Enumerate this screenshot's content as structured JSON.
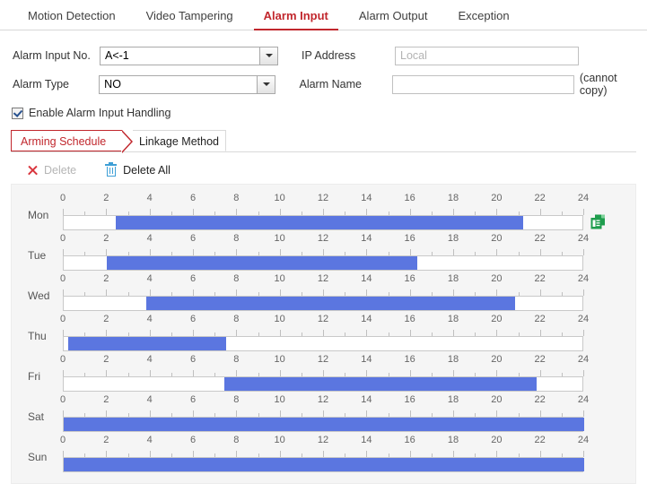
{
  "tabs": [
    {
      "label": "Motion Detection",
      "active": false
    },
    {
      "label": "Video Tampering",
      "active": false
    },
    {
      "label": "Alarm Input",
      "active": true
    },
    {
      "label": "Alarm Output",
      "active": false
    },
    {
      "label": "Exception",
      "active": false
    }
  ],
  "form": {
    "alarm_input_no_label": "Alarm Input No.",
    "alarm_input_no_value": "A<-1",
    "ip_address_label": "IP Address",
    "ip_address_value": "",
    "ip_address_placeholder": "Local",
    "alarm_type_label": "Alarm Type",
    "alarm_type_value": "NO",
    "alarm_name_label": "Alarm Name",
    "alarm_name_value": "",
    "alarm_name_placeholder": "",
    "cannot_copy_hint": "(cannot copy)"
  },
  "enable_checkbox": {
    "label": "Enable Alarm Input Handling",
    "checked": true
  },
  "subtabs": [
    {
      "label": "Arming Schedule",
      "active": true
    },
    {
      "label": "Linkage Method",
      "active": false
    }
  ],
  "toolbar": {
    "delete_label": "Delete",
    "delete_enabled": false,
    "delete_all_label": "Delete All",
    "delete_icon": "close-x-icon",
    "delete_all_icon": "trash-icon"
  },
  "colors": {
    "accent_red": "#c1272d",
    "segment_blue": "#5b76e0",
    "copy_green": "#1f9d4d",
    "trash_blue": "#3e9fd6",
    "panel_bg": "#f5f5f5"
  },
  "chart_data": {
    "type": "bar",
    "title": "Arming Schedule",
    "xlabel": "",
    "ylabel": "",
    "xlim": [
      0,
      24
    ],
    "grid": true,
    "axis_ticks": [
      0,
      2,
      4,
      6,
      8,
      10,
      12,
      14,
      16,
      18,
      20,
      22,
      24
    ],
    "tick_labels": [
      "0",
      "2",
      "4",
      "6",
      "8",
      "10",
      "12",
      "14",
      "16",
      "18",
      "20",
      "22",
      "24"
    ],
    "minor_tick_step": 1,
    "categories": [
      "Mon",
      "Tue",
      "Wed",
      "Thu",
      "Fri",
      "Sat",
      "Sun"
    ],
    "legend": [],
    "rows": [
      {
        "day": "Mon",
        "segments": [
          {
            "start": 2.4,
            "end": 21.2
          }
        ],
        "copy_icon": true
      },
      {
        "day": "Tue",
        "segments": [
          {
            "start": 2.0,
            "end": 16.3
          }
        ],
        "copy_icon": false
      },
      {
        "day": "Wed",
        "segments": [
          {
            "start": 3.8,
            "end": 20.8
          }
        ],
        "copy_icon": false
      },
      {
        "day": "Thu",
        "segments": [
          {
            "start": 0.2,
            "end": 7.5
          }
        ],
        "copy_icon": false
      },
      {
        "day": "Fri",
        "segments": [
          {
            "start": 7.4,
            "end": 21.8
          }
        ],
        "copy_icon": false
      },
      {
        "day": "Sat",
        "segments": [
          {
            "start": 0.0,
            "end": 24.0
          }
        ],
        "copy_icon": false
      },
      {
        "day": "Sun",
        "segments": [
          {
            "start": 0.0,
            "end": 24.0
          }
        ],
        "copy_icon": false
      }
    ]
  }
}
